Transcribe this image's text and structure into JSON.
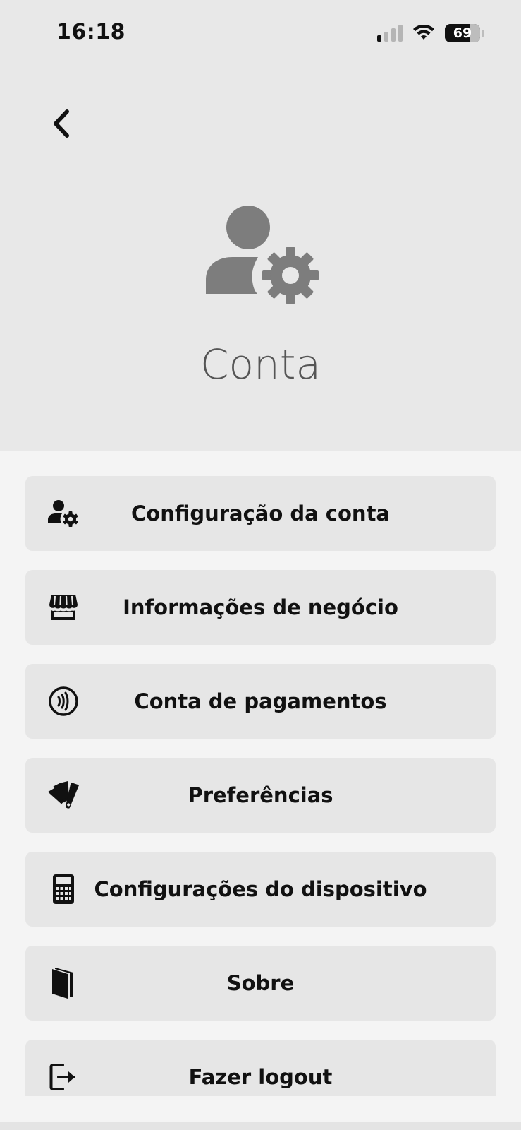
{
  "status_bar": {
    "time": "16:18",
    "battery": "69",
    "battery_level": 0.69,
    "signal_bars_active": 1
  },
  "header": {
    "title": "Conta",
    "icon": "user-gear-icon"
  },
  "menu": {
    "items": [
      {
        "label": "Configuração da conta",
        "icon": "user-gear-icon"
      },
      {
        "label": "Informações de negócio",
        "icon": "storefront-icon"
      },
      {
        "label": "Conta de pagamentos",
        "icon": "contactless-icon"
      },
      {
        "label": "Preferências",
        "icon": "swatch-icon"
      },
      {
        "label": "Configurações do dispositivo",
        "icon": "calculator-icon"
      },
      {
        "label": "Sobre",
        "icon": "book-icon"
      },
      {
        "label": "Fazer logout",
        "icon": "logout-icon"
      }
    ]
  },
  "colors": {
    "header_bg": "#e8e8e8",
    "page_bg": "#f4f4f4",
    "item_bg": "#e6e6e6",
    "icon_gray": "#7d7d7d",
    "text": "#111111"
  }
}
